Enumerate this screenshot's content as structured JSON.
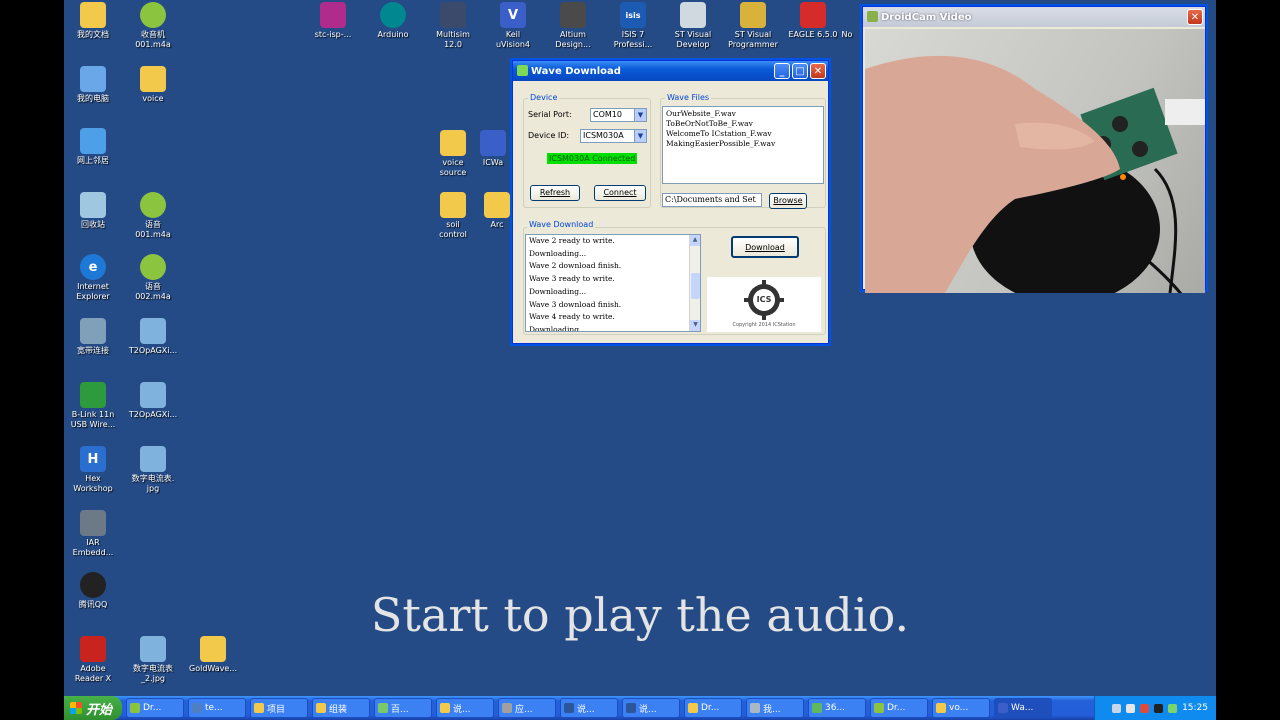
{
  "desktop_icons": [
    {
      "label": "我的文档",
      "icon": "folder-icon",
      "color": "#f3c94b"
    },
    {
      "label": "收音机\n001.m4a",
      "icon": "audio-file-icon",
      "color": "#8bc53f"
    },
    {
      "label": "我的电脑",
      "icon": "computer-icon",
      "color": "#6aa7e8"
    },
    {
      "label": "voice",
      "icon": "folder-icon",
      "color": "#f3c94b"
    },
    {
      "label": "网上邻居",
      "icon": "network-icon",
      "color": "#4da0e8"
    },
    {
      "label": "回收站",
      "icon": "recycle-bin-icon",
      "color": "#9fc7e0"
    },
    {
      "label": "语音\n001.m4a",
      "icon": "audio-file-icon",
      "color": "#8bc53f"
    },
    {
      "label": "Internet\nExplorer",
      "icon": "ie-icon",
      "color": "#1e78d6"
    },
    {
      "label": "语音\n002.m4a",
      "icon": "audio-file-icon",
      "color": "#8bc53f"
    },
    {
      "label": "宽带连接",
      "icon": "broadband-icon",
      "color": "#7fa0b8"
    },
    {
      "label": "T2OpAGXi...",
      "icon": "image-file-icon",
      "color": "#7fb3de"
    },
    {
      "label": "B-Link 11n\nUSB Wire...",
      "icon": "wireless-icon",
      "color": "#2d9a3d"
    },
    {
      "label": "T2OpAGXi...",
      "icon": "image-file-icon",
      "color": "#7fb3de"
    },
    {
      "label": "Hex\nWorkshop",
      "icon": "hex-icon",
      "color": "#2a6fd0"
    },
    {
      "label": "数字电流表.\njpg",
      "icon": "image-file-icon",
      "color": "#7fb3de"
    },
    {
      "label": "IAR\nEmbedd...",
      "icon": "iar-icon",
      "color": "#6b7a86"
    },
    {
      "label": "腾讯QQ",
      "icon": "qq-icon",
      "color": "#222222"
    },
    {
      "label": "Adobe\nReader X",
      "icon": "pdf-icon",
      "color": "#c8231d"
    },
    {
      "label": "数字电流表\n_2.jpg",
      "icon": "image-file-icon",
      "color": "#7fb3de"
    },
    {
      "label": "GoldWave...",
      "icon": "folder-icon",
      "color": "#f3c94b"
    },
    {
      "label": "stc-isp-...",
      "icon": "stc-icon",
      "color": "#b02c8c"
    },
    {
      "label": "Arduino",
      "icon": "arduino-icon",
      "color": "#00878f"
    },
    {
      "label": "Multisim\n12.0",
      "icon": "multisim-icon",
      "color": "#3b4a6b"
    },
    {
      "label": "Keil\nuVision4",
      "icon": "keil-icon",
      "color": "#3b5fc9"
    },
    {
      "label": "Altium\nDesign...",
      "icon": "altium-icon",
      "color": "#4a4a4a"
    },
    {
      "label": "ISIS 7\nProfessi...",
      "icon": "isis-icon",
      "color": "#1b5bb3"
    },
    {
      "label": "ST Visual\nDevelop",
      "icon": "st-develop-icon",
      "color": "#d0d8e0"
    },
    {
      "label": "ST Visual\nProgrammer",
      "icon": "st-programmer-icon",
      "color": "#d8b23a"
    },
    {
      "label": "EAGLE 6.5.0",
      "icon": "eagle-icon",
      "color": "#d62b2b"
    },
    {
      "label": "No",
      "icon": "file-icon",
      "color": "#dddddd"
    },
    {
      "label": "voice\nsource",
      "icon": "folder-icon",
      "color": "#f3c94b"
    },
    {
      "label": "ICWa",
      "icon": "file-icon",
      "color": "#3b5fc9"
    },
    {
      "label": "soil\ncontrol",
      "icon": "folder-icon",
      "color": "#f3c94b"
    },
    {
      "label": "Arc",
      "icon": "folder-icon",
      "color": "#f3c94b"
    }
  ],
  "wave_window": {
    "title": "Wave Download",
    "device_group": "Device",
    "serial_port_label": "Serial Port:",
    "serial_port_value": "COM10",
    "device_id_label": "Device ID:",
    "device_id_value": "ICSM030A",
    "status": "ICSM030A Connected",
    "refresh_label": "Refresh",
    "connect_label": "Connect",
    "wave_files_group": "Wave Files",
    "wave_files": [
      "OurWebsite_F.wav",
      "ToBeOrNotToBe_F.wav",
      "WelcomeTo ICstation_F.wav",
      "MakingEasierPossible_F.wav"
    ],
    "path_value": "C:\\Documents and Set",
    "browse_label": "Browse",
    "wave_download_group": "Wave Download",
    "log": [
      "Wave 2 ready to write.",
      "Downloading...",
      "Wave 2 download finish.",
      "Wave 3 ready to write.",
      "Downloading...",
      "Wave 3 download finish.",
      "Wave 4 ready to write.",
      "Downloading..."
    ],
    "download_label": "Download",
    "logo_text": "ICS",
    "copyright": "Copyright 2014 ICStation"
  },
  "droidcam": {
    "title": "DroidCam Video"
  },
  "caption": "Start to play the audio.",
  "taskbar": {
    "start_label": "开始",
    "items": [
      {
        "label": "Dr...",
        "color": "#8bc53f"
      },
      {
        "label": "te...",
        "color": "#4f7fc0"
      },
      {
        "label": "项目",
        "color": "#f3c94b"
      },
      {
        "label": "组装",
        "color": "#f3c94b"
      },
      {
        "label": "百...",
        "color": "#7ac86c"
      },
      {
        "label": "说...",
        "color": "#f3c94b"
      },
      {
        "label": "应...",
        "color": "#a0a0a0"
      },
      {
        "label": "说...",
        "color": "#2b579a"
      },
      {
        "label": "说...",
        "color": "#2b579a"
      },
      {
        "label": "Dr...",
        "color": "#f3c94b"
      },
      {
        "label": "我...",
        "color": "#aab7c7"
      },
      {
        "label": "36...",
        "color": "#5fb85f"
      },
      {
        "label": "Dr...",
        "color": "#8bc53f"
      },
      {
        "label": "vo...",
        "color": "#f3c94b"
      },
      {
        "label": "Wa...",
        "color": "#3b5fc9"
      }
    ],
    "clock": "15:25"
  }
}
